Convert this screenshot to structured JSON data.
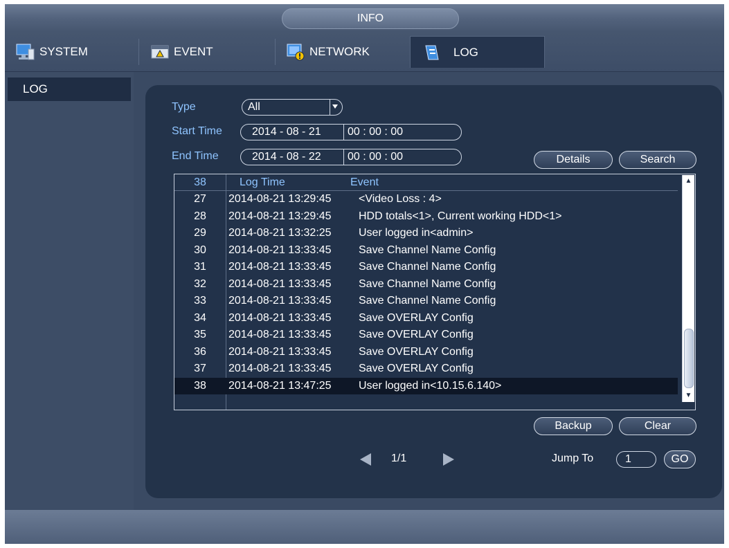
{
  "title": "INFO",
  "tabs": [
    {
      "label": "SYSTEM",
      "icon": "system-icon"
    },
    {
      "label": "EVENT",
      "icon": "event-icon"
    },
    {
      "label": "NETWORK",
      "icon": "network-icon"
    },
    {
      "label": "LOG",
      "icon": "log-icon",
      "active": true
    }
  ],
  "sidebar": {
    "items": [
      {
        "label": "LOG",
        "selected": true
      }
    ]
  },
  "filters": {
    "type_label": "Type",
    "type_value": "All",
    "start_label": "Start Time",
    "start_date": "2014 - 08 - 21",
    "start_time": "00 : 00 : 00",
    "end_label": "End Time",
    "end_date": "2014 - 08 - 22",
    "end_time": "00 : 00 : 00"
  },
  "buttons": {
    "details": "Details",
    "search": "Search",
    "backup": "Backup",
    "clear": "Clear",
    "go": "GO"
  },
  "table": {
    "headers": [
      "38",
      "Log Time",
      "Event"
    ],
    "rows": [
      {
        "no": "27",
        "time": "2014-08-21 13:29:45",
        "event": "<Video Loss : 4>"
      },
      {
        "no": "28",
        "time": "2014-08-21 13:29:45",
        "event": "HDD totals<1>, Current working HDD<1>"
      },
      {
        "no": "29",
        "time": "2014-08-21 13:32:25",
        "event": "User logged in<admin>"
      },
      {
        "no": "30",
        "time": "2014-08-21 13:33:45",
        "event": "Save Channel Name Config"
      },
      {
        "no": "31",
        "time": "2014-08-21 13:33:45",
        "event": "Save Channel Name Config"
      },
      {
        "no": "32",
        "time": "2014-08-21 13:33:45",
        "event": "Save Channel Name Config"
      },
      {
        "no": "33",
        "time": "2014-08-21 13:33:45",
        "event": "Save Channel Name Config"
      },
      {
        "no": "34",
        "time": "2014-08-21 13:33:45",
        "event": "Save OVERLAY Config"
      },
      {
        "no": "35",
        "time": "2014-08-21 13:33:45",
        "event": "Save OVERLAY Config"
      },
      {
        "no": "36",
        "time": "2014-08-21 13:33:45",
        "event": "Save OVERLAY Config"
      },
      {
        "no": "37",
        "time": "2014-08-21 13:33:45",
        "event": "Save OVERLAY Config"
      },
      {
        "no": "38",
        "time": "2014-08-21 13:47:25",
        "event": "User logged in<10.15.6.140>",
        "selected": true
      }
    ]
  },
  "pager": {
    "page": "1/1",
    "jump_label": "Jump To",
    "jump_value": "1"
  },
  "colors": {
    "background": "#3a4a63",
    "panel": "#23334a",
    "label": "#8fc4ff",
    "selected_row": "#0e1727"
  }
}
